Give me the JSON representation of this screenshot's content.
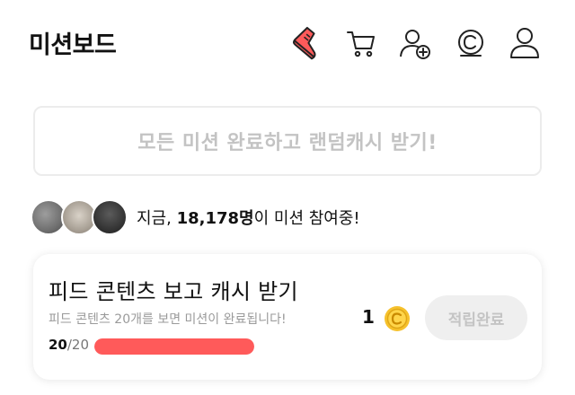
{
  "header": {
    "title": "미션보드",
    "icons": [
      "sneaker-icon",
      "cart-icon",
      "add-friend-icon",
      "cash-coin-icon",
      "profile-icon"
    ],
    "accent_color": "#ff5a5a"
  },
  "banner": {
    "text": "모든 미션 완료하고 랜덤캐시 받기!"
  },
  "participants": {
    "prefix": "지금, ",
    "count": "18,178명",
    "suffix": "이 미션 참여중!"
  },
  "mission": {
    "title": "피드 콘텐츠 보고 캐시 받기",
    "subtitle": "피드 콘텐츠 20개를 보면 미션이 완료됩니다!",
    "progress_current": "20",
    "progress_total": "/20",
    "progress_fraction": 1.0,
    "progress_color": "#ff5a5a",
    "reward_amount": "1",
    "reward_icon": "gold-coin-icon",
    "status_label": "적립완료"
  }
}
